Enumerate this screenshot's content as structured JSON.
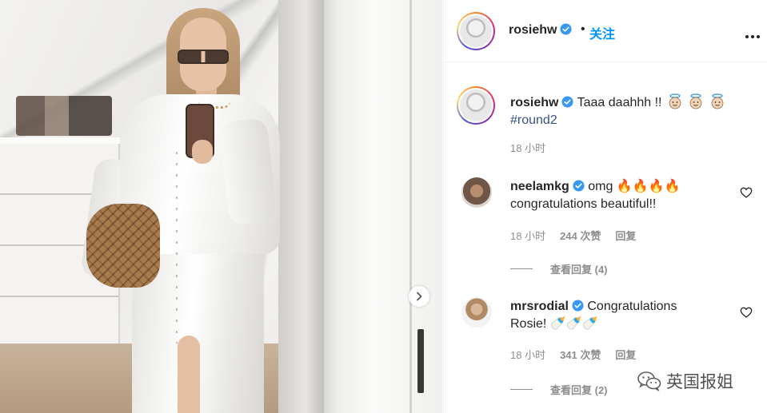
{
  "post": {
    "username": "rosiehw",
    "follow_label": "关注",
    "separator": "•",
    "verified_icon": "verified-badge-icon",
    "more_icon": "more-options-icon"
  },
  "caption": {
    "username": "rosiehw",
    "text": "Taaa daahhh !!",
    "emoji": [
      "👼",
      "👼",
      "👼"
    ],
    "hashtag": "#round2",
    "time": "18 小时"
  },
  "comments": [
    {
      "username": "neelamkg",
      "text_line1": "omg 🔥🔥🔥🔥",
      "text_line2": "congratulations beautiful!!",
      "time": "18 小时",
      "likes": "244 次赞",
      "reply_label": "回复",
      "view_replies": "查看回复 (4)"
    },
    {
      "username": "mrsrodial",
      "text_line1": "Congratulations",
      "text_line2": "Rosie! 🍼🍼🍼",
      "time": "18 小时",
      "likes": "341 次赞",
      "reply_label": "回复",
      "view_replies": "查看回复 (2)"
    }
  ],
  "watermark": {
    "text": "英国报姐",
    "icon": "wechat-icon"
  },
  "colors": {
    "link_blue": "#0095f6",
    "hashtag": "#385185",
    "meta_gray": "#8e8e8e",
    "text": "#262626"
  }
}
